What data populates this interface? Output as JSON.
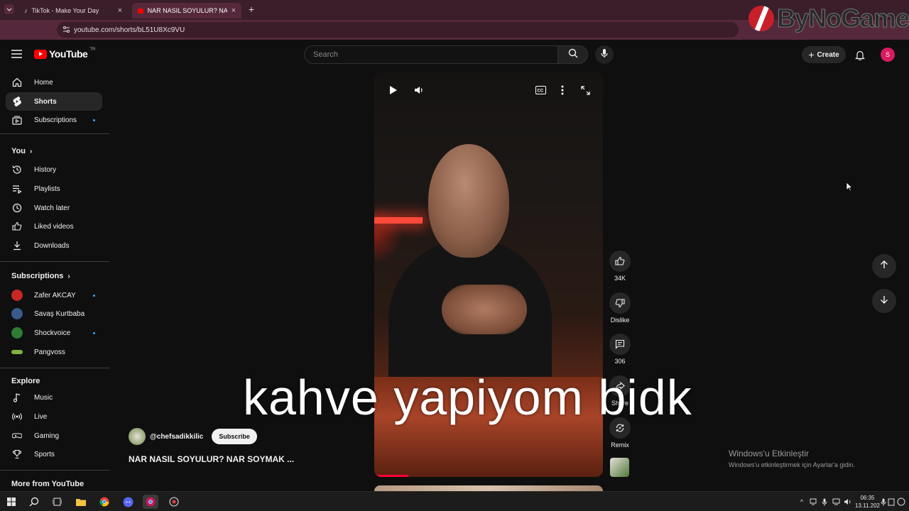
{
  "browser": {
    "tabs": [
      {
        "title": "TikTok - Make Your Day",
        "active": false
      },
      {
        "title": "NAR NASIL SOYULUR? NAR SO",
        "active": true
      }
    ],
    "url": "youtube.com/shorts/bL51U8Xc9VU"
  },
  "watermark": {
    "text": "ByNoGame"
  },
  "masthead": {
    "logo_text": "YouTube",
    "country_code": "TR",
    "search_placeholder": "Search",
    "create_label": "Create",
    "avatar_letter": "S"
  },
  "sidebar": {
    "main": [
      {
        "label": "Home",
        "icon": "home-icon"
      },
      {
        "label": "Shorts",
        "icon": "shorts-icon",
        "active": true
      },
      {
        "label": "Subscriptions",
        "icon": "subscriptions-icon",
        "dot": true
      }
    ],
    "you_header": "You",
    "you": [
      {
        "label": "History",
        "icon": "history-icon"
      },
      {
        "label": "Playlists",
        "icon": "playlists-icon"
      },
      {
        "label": "Watch later",
        "icon": "clock-icon"
      },
      {
        "label": "Liked videos",
        "icon": "thumbs-up-icon"
      },
      {
        "label": "Downloads",
        "icon": "download-icon"
      }
    ],
    "subs_header": "Subscriptions",
    "subscriptions": [
      {
        "label": "Zafer AKCAY",
        "color": "#c62828",
        "dot": true
      },
      {
        "label": "Savaş Kurtbaba",
        "color": "#3a5a8a",
        "dot": false
      },
      {
        "label": "Shockvoice",
        "color": "#2e7d32",
        "dot": true
      },
      {
        "label": "Pangvoss",
        "color": "#7cb342",
        "dot": false
      }
    ],
    "explore_header": "Explore",
    "explore": [
      {
        "label": "Music",
        "icon": "music-icon"
      },
      {
        "label": "Live",
        "icon": "live-icon"
      },
      {
        "label": "Gaming",
        "icon": "gaming-icon"
      },
      {
        "label": "Sports",
        "icon": "trophy-icon"
      }
    ],
    "more_header": "More from YouTube"
  },
  "short": {
    "channel": "@chefsadikkilic",
    "subscribe_label": "Subscribe",
    "title": "NAR NASIL SOYULUR? NAR SOYMAK ...",
    "actions": {
      "like_count": "34K",
      "dislike_label": "Dislike",
      "comment_count": "306",
      "share_label": "Share",
      "remix_label": "Remix"
    }
  },
  "caption": "kahve yapiyom bidk",
  "activation": {
    "title": "Windows'u Etkinleştir",
    "subtitle": "Windows'u etkinleştirmek için Ayarlar'a gidin."
  },
  "taskbar": {
    "time": "06:35",
    "date": "13.11.202"
  }
}
